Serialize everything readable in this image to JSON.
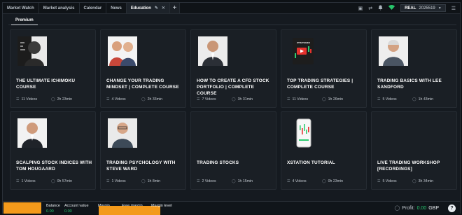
{
  "topbar": {
    "tabs": [
      {
        "label": "Market Watch"
      },
      {
        "label": "Market analysis"
      },
      {
        "label": "Calendar"
      },
      {
        "label": "News"
      },
      {
        "label": "Education"
      }
    ],
    "add_tab": "+",
    "account_type": "REAL",
    "account_number": "2025519"
  },
  "subtabs": {
    "active": "Premium"
  },
  "courses": [
    {
      "title": "THE ULTIMATE ICHIMOKU COURSE",
      "videos": "11 Videos",
      "duration": "2h 23min"
    },
    {
      "title": "CHANGE YOUR TRADING MINDSET | COMPLETE COURSE",
      "videos": "4 Videos",
      "duration": "2h 33min"
    },
    {
      "title": "HOW TO CREATE A CFD STOCK PORTFOLIO | COMPLETE COURSE",
      "videos": "7 Videos",
      "duration": "3h 31min"
    },
    {
      "title": "TOP TRADING STRATEGIES | COMPLETE COURSE",
      "videos": "11 Videos",
      "duration": "1h 26min",
      "thumb_text": "STRATEGIES"
    },
    {
      "title": "TRADING BASICS WITH LEE SANDFORD",
      "videos": "5 Videos",
      "duration": "1h 43min"
    },
    {
      "title": "SCALPING STOCK INDICES WITH TOM HOUGAARD",
      "videos": "1 Videos",
      "duration": "0h 57min"
    },
    {
      "title": "TRADING PSYCHOLOGY WITH STEVE WARD",
      "videos": "1 Videos",
      "duration": "1h 8min"
    },
    {
      "title": "TRADING STOCKS",
      "videos": "2 Videos",
      "duration": "1h 15min"
    },
    {
      "title": "XSTATION TUTORIAL",
      "videos": "4 Videos",
      "duration": "0h 23min"
    },
    {
      "title": "LIVE TRADING WORKSHOP [RECORDINGS]",
      "videos": "5 Videos",
      "duration": "3h 34min"
    }
  ],
  "footer": {
    "balance": {
      "label": "Balance",
      "value": "0.00"
    },
    "account_value": {
      "label": "Account value",
      "value": "0.00"
    },
    "margin": {
      "label": "Margin",
      "value": "0.00"
    },
    "free_margin": {
      "label": "Free margin",
      "value": "0.00"
    },
    "margin_level": {
      "label": "Margin level",
      "value": "-"
    },
    "profit_label": "Profit:",
    "profit_value": "0.00",
    "profit_currency": "GBP",
    "help": "?"
  },
  "colors": {
    "accent_orange": "#f39a1b",
    "positive": "#28c76f",
    "background": "#151a20",
    "card": "#1a1f25"
  },
  "icons": [
    "screen-icon",
    "exchange-icon",
    "bell-icon",
    "wifi-icon",
    "menu-icon",
    "videos-icon",
    "clock-icon"
  ]
}
